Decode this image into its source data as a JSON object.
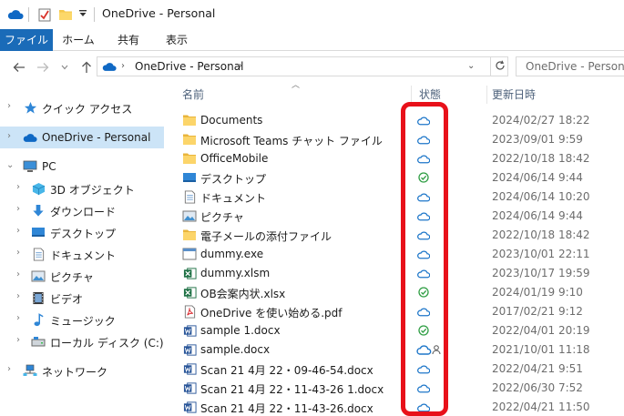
{
  "window": {
    "title": "OneDrive - Personal"
  },
  "ribbon": {
    "tabs": [
      "ファイル",
      "ホーム",
      "共有",
      "表示"
    ],
    "active": 0
  },
  "address": {
    "path": "OneDrive - Personal",
    "search_placeholder": "OneDrive - Personal(("
  },
  "nav": {
    "items": [
      {
        "label": "クイック アクセス",
        "icon": "star-icon"
      },
      {
        "label": "OneDrive - Personal",
        "icon": "cloud-icon",
        "selected": true
      },
      {
        "label": "PC",
        "icon": "pc-icon"
      },
      {
        "label": "3D オブジェクト",
        "icon": "cube-icon"
      },
      {
        "label": "ダウンロード",
        "icon": "download-icon"
      },
      {
        "label": "デスクトップ",
        "icon": "desktop-icon"
      },
      {
        "label": "ドキュメント",
        "icon": "document-icon"
      },
      {
        "label": "ピクチャ",
        "icon": "picture-icon"
      },
      {
        "label": "ビデオ",
        "icon": "video-icon"
      },
      {
        "label": "ミュージック",
        "icon": "music-icon"
      },
      {
        "label": "ローカル ディスク (C:)",
        "icon": "disk-icon"
      },
      {
        "label": "ネットワーク",
        "icon": "network-icon"
      }
    ]
  },
  "columns": {
    "name": "名前",
    "status": "状態",
    "date": "更新日時"
  },
  "files": [
    {
      "name": "Documents",
      "type": "folder",
      "status": "cloud",
      "date": "2024/02/27 18:22"
    },
    {
      "name": "Microsoft Teams チャット ファイル",
      "type": "folder",
      "status": "cloud",
      "date": "2023/09/01 9:59"
    },
    {
      "name": "OfficeMobile",
      "type": "folder",
      "status": "cloud",
      "date": "2022/10/18 18:42"
    },
    {
      "name": "デスクトップ",
      "type": "desktop",
      "status": "synced",
      "date": "2024/06/14 9:44"
    },
    {
      "name": "ドキュメント",
      "type": "document",
      "status": "cloud",
      "date": "2024/06/14 10:20"
    },
    {
      "name": "ピクチャ",
      "type": "picture",
      "status": "cloud",
      "date": "2024/06/14 9:44"
    },
    {
      "name": "電子メールの添付ファイル",
      "type": "folder",
      "status": "cloud",
      "date": "2022/10/18 18:42"
    },
    {
      "name": "dummy.exe",
      "type": "exe",
      "status": "cloud",
      "date": "2023/10/01 22:11"
    },
    {
      "name": "dummy.xlsm",
      "type": "excel",
      "status": "cloud",
      "date": "2023/10/17 19:59"
    },
    {
      "name": "OB会案内状.xlsx",
      "type": "excel",
      "status": "synced",
      "date": "2024/01/19 9:10"
    },
    {
      "name": "OneDrive を使い始める.pdf",
      "type": "pdf",
      "status": "cloud",
      "date": "2017/02/21 9:12"
    },
    {
      "name": "sample 1.docx",
      "type": "word",
      "status": "synced",
      "date": "2022/04/01 20:19"
    },
    {
      "name": "sample.docx",
      "type": "word",
      "status": "cloud-shared",
      "date": "2021/10/01 11:18"
    },
    {
      "name": "Scan 21 4月 22・09-46-54.docx",
      "type": "word",
      "status": "cloud",
      "date": "2022/04/21 9:51"
    },
    {
      "name": "Scan 21 4月 22・11-43-26 1.docx",
      "type": "word",
      "status": "cloud",
      "date": "2022/06/30 7:52"
    },
    {
      "name": "Scan 21 4月 22・11-43-26.docx",
      "type": "word",
      "status": "cloud",
      "date": "2022/04/21 11:50"
    }
  ],
  "colors": {
    "accent": "#1a6bb8",
    "selected": "#cce4f7",
    "cloud": "#1d76c9",
    "synced": "#2f9e44",
    "highlight": "#e8111a"
  }
}
